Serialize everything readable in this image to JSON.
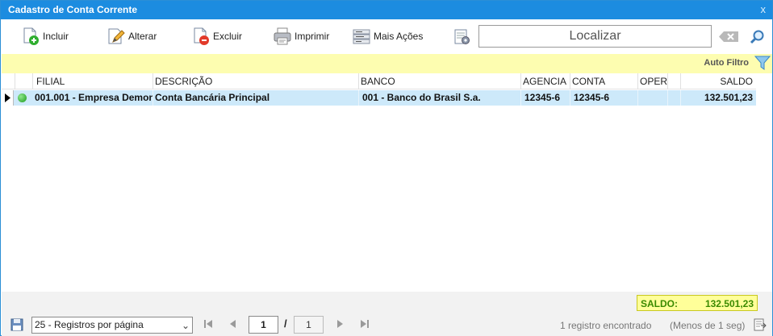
{
  "window": {
    "title": "Cadastro de Conta Corrente",
    "close_label": "x"
  },
  "toolbar": {
    "incluir": "Incluir",
    "alterar": "Alterar",
    "excluir": "Excluir",
    "imprimir": "Imprimir",
    "mais_acoes": "Mais Ações"
  },
  "search": {
    "value": "Localizar"
  },
  "filter": {
    "auto_filtro": "Auto Filtro"
  },
  "grid": {
    "columns": [
      "FILIAL",
      "DESCRIÇÃO",
      "BANCO",
      "AGENCIA",
      "CONTA",
      "OPER",
      "SALDO"
    ],
    "rows": [
      {
        "filial": "001.001 - Empresa Demon",
        "descricao": "Conta Bancária Principal",
        "banco": "001 - Banco do Brasil S.a.",
        "agencia": "12345-6",
        "conta": "12345-6",
        "oper": "",
        "saldo": "132.501,23"
      }
    ]
  },
  "summary": {
    "label": "SALDO:",
    "value": "132.501,23"
  },
  "footer": {
    "page_size": "25 - Registros por página",
    "page": "1",
    "separator": "/",
    "total_pages": "1",
    "count_text": "1 registro encontrado",
    "time_text": "(Menos de 1 seg)"
  },
  "colors": {
    "titlebar": "#1c8ce0",
    "filterbar": "#fdfdb0",
    "row_selected": "#cde9fa",
    "saldo_bg": "#ffff99",
    "saldo_text": "#3a8a00"
  },
  "icons": [
    "incluir-icon",
    "alterar-icon",
    "excluir-icon",
    "imprimir-icon",
    "mais-acoes-icon",
    "settings-icon",
    "clear-search-icon",
    "search-icon",
    "filter-funnel-icon",
    "row-pointer-icon",
    "status-dot-icon",
    "save-icon",
    "first-page-icon",
    "prev-page-icon",
    "next-page-icon",
    "last-page-icon",
    "export-icon"
  ]
}
